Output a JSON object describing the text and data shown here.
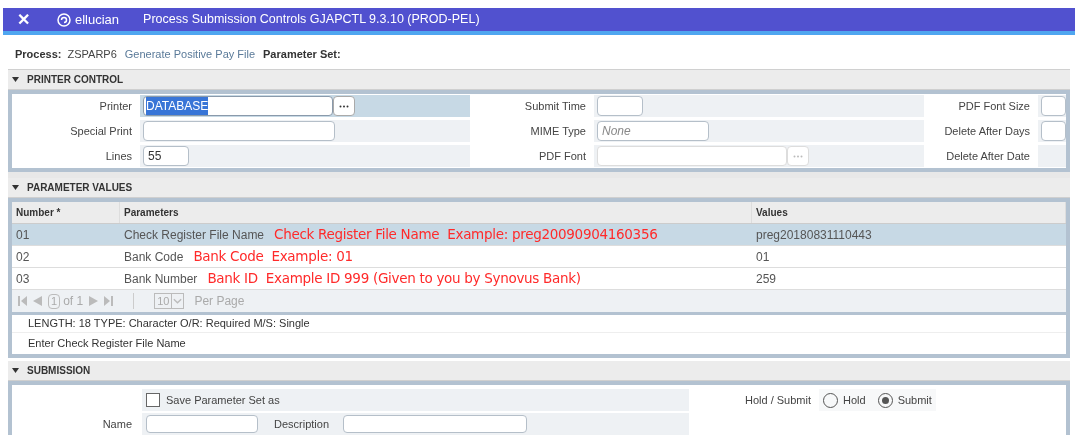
{
  "header": {
    "close": "✕",
    "brand": "ellucian",
    "title": "Process Submission Controls GJAPCTL 9.3.10 (PROD-PEL)"
  },
  "process": {
    "label": "Process:",
    "code": "ZSPARP6",
    "name": "Generate Positive Pay File",
    "parameter_set_label": "Parameter Set:"
  },
  "printer_control": {
    "title": "PRINTER CONTROL",
    "expanded": true,
    "rows": [
      [
        {
          "label": "Printer",
          "value": "DATABASE",
          "kind": "lookup",
          "selected": true
        },
        {
          "label": "Submit Time",
          "kind": "short"
        },
        {
          "label": "PDF Font Size",
          "kind": "cut"
        }
      ],
      [
        {
          "label": "Special Print",
          "kind": "text"
        },
        {
          "label": "MIME Type",
          "placeholder": "None",
          "kind": "medium"
        },
        {
          "label": "Delete After Days",
          "kind": "cut"
        }
      ],
      [
        {
          "label": "Lines",
          "value": "55",
          "kind": "short"
        },
        {
          "label": "PDF Font",
          "kind": "lookup_disabled"
        },
        {
          "label": "Delete After Date",
          "kind": "none"
        }
      ]
    ]
  },
  "parameter_values": {
    "title": "PARAMETER VALUES",
    "expanded": true,
    "columns": [
      "Number *",
      "Parameters",
      "Values"
    ],
    "rows": [
      {
        "number": "01",
        "parameter": "Check Register File Name",
        "annotation": "Check Register File Name  Example: preg20090904160356",
        "value": "preg20180831110443",
        "selected": true
      },
      {
        "number": "02",
        "parameter": "Bank Code",
        "annotation": "Bank Code  Example: 01",
        "value": "01",
        "selected": false
      },
      {
        "number": "03",
        "parameter": "Bank Number",
        "annotation": "Bank ID  Example ID 999 (Given to you by Synovus Bank)",
        "value": "259",
        "selected": false
      }
    ],
    "pager": {
      "page": "1",
      "of": "of 1",
      "per_page": "10",
      "per_page_label": "Per Page"
    },
    "info": [
      "LENGTH: 18 TYPE: Character O/R: Required M/S: Single",
      "Enter Check Register File Name"
    ]
  },
  "submission": {
    "title": "SUBMISSION",
    "expanded": true,
    "save": {
      "label": "Save Parameter Set as",
      "checked": false
    },
    "name_label": "Name",
    "description_label": "Description",
    "hold_submit_label": "Hold / Submit",
    "options": [
      {
        "label": "Hold",
        "selected": false
      },
      {
        "label": "Submit",
        "selected": true
      }
    ]
  }
}
